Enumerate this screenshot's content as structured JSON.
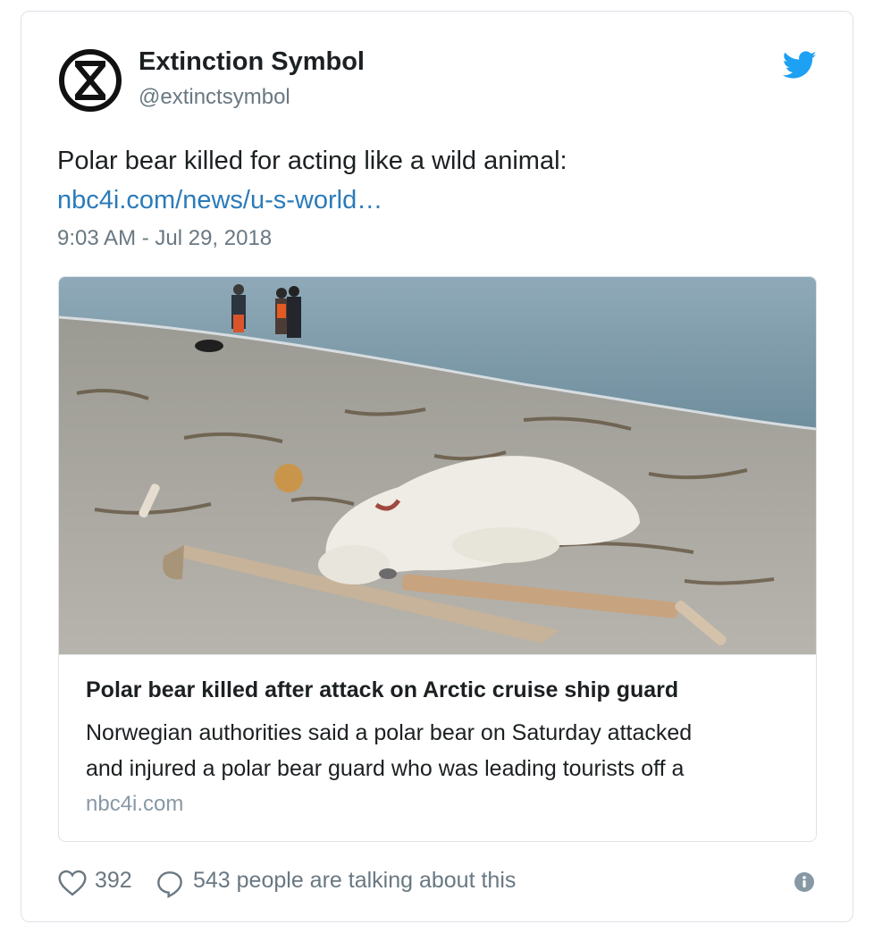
{
  "tweet": {
    "author_name": "Extinction Symbol",
    "author_handle": "@extinctsymbol",
    "text": "Polar bear killed for acting like a wild animal:",
    "link_text": "nbc4i.com/news/u-s-world…",
    "timestamp": "9:03 AM - Jul 29, 2018",
    "avatar_icon": "hourglass-circle-icon",
    "platform_icon": "twitter-bird-icon",
    "colors": {
      "link": "#2b7bb9",
      "twitter_blue": "#1da1f2",
      "secondary_text": "#697882",
      "primary_text": "#1c2022",
      "border": "#dde3e8"
    }
  },
  "link_card": {
    "image_alt": "polar-bear-on-beach-photo",
    "title": "Polar bear killed after attack on Arctic cruise ship guard",
    "description_line1": "Norwegian authorities said a polar bear on Saturday attacked",
    "description_line2": "and injured a polar bear guard who was leading tourists off a",
    "domain": "nbc4i.com"
  },
  "actions": {
    "like_icon": "heart-icon",
    "like_count": "392",
    "reply_icon": "speech-bubble-icon",
    "talking_text": "543 people are talking about this",
    "info_icon": "info-icon"
  }
}
